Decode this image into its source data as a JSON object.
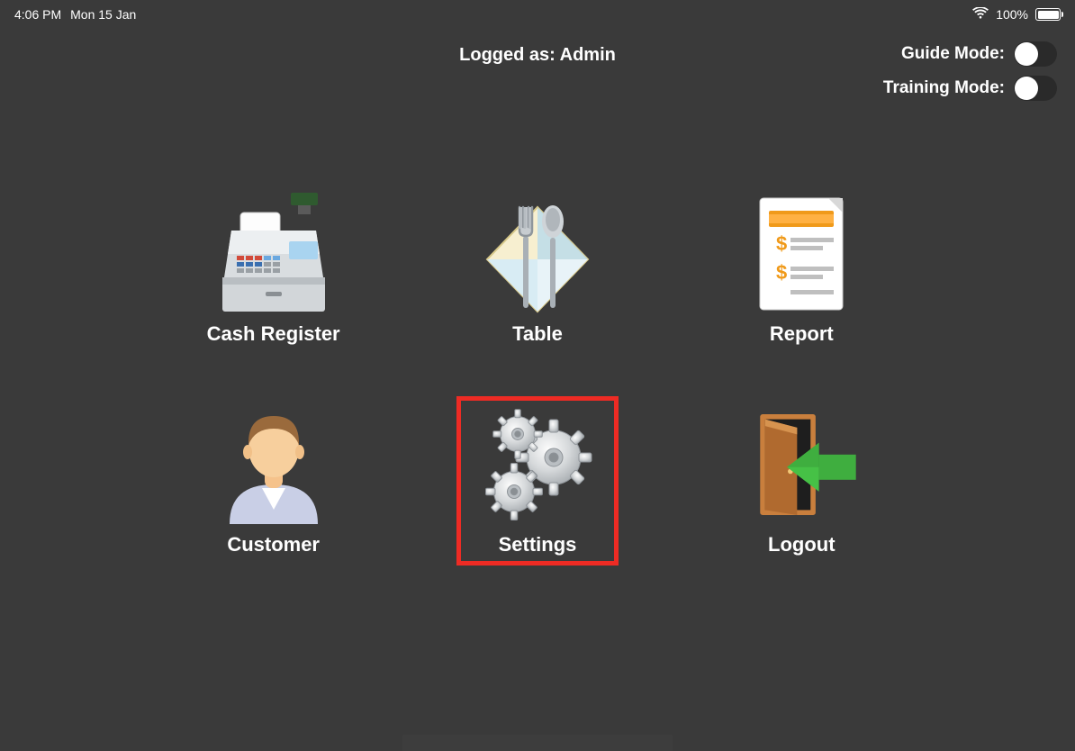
{
  "status": {
    "time": "4:06 PM",
    "date": "Mon 15 Jan",
    "battery_pct": "100%"
  },
  "header": {
    "logged_as_label": "Logged as:",
    "logged_as_user": "Admin",
    "guide_mode_label": "Guide Mode:",
    "training_mode_label": "Training Mode:",
    "guide_mode_on": false,
    "training_mode_on": false
  },
  "menu": {
    "cash_register": "Cash Register",
    "table": "Table",
    "report": "Report",
    "customer": "Customer",
    "settings": "Settings",
    "logout": "Logout",
    "highlighted": "settings"
  }
}
